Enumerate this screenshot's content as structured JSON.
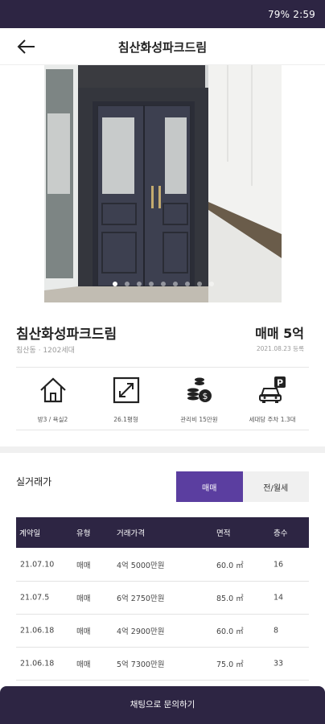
{
  "status_bar": {
    "text": "79% 2:59"
  },
  "header": {
    "title": "침산화성파크드림"
  },
  "gallery": {
    "slide_count": 9,
    "active_index": 0
  },
  "property": {
    "name": "침산화성파크드림",
    "subtitle": "침산동 · 1202세대",
    "price": "매매 5억",
    "date": "2021.08.23 등록"
  },
  "features": [
    {
      "icon": "house-icon",
      "label": "방3 / 욕실2"
    },
    {
      "icon": "expand-arrows-icon",
      "label": "26.1평형"
    },
    {
      "icon": "coins-icon",
      "label": "관리비 15만원"
    },
    {
      "icon": "car-parking-icon",
      "label": "세대당 주차 1.3대"
    }
  ],
  "transactions": {
    "title": "실거래가",
    "tabs": [
      {
        "label": "매매",
        "active": true
      },
      {
        "label": "전/월세",
        "active": false
      }
    ],
    "columns": [
      "계약일",
      "유형",
      "거래가격",
      "면적",
      "층수"
    ],
    "rows": [
      [
        "21.07.10",
        "매매",
        "4억 5000만원",
        "60.0 ㎡",
        "16"
      ],
      [
        "21.07.5",
        "매매",
        "6억 2750만원",
        "85.0 ㎡",
        "14"
      ],
      [
        "21.06.18",
        "매매",
        "4억 2900만원",
        "60.0 ㎡",
        "8"
      ],
      [
        "21.06.18",
        "매매",
        "5억 7300만원",
        "75.0 ㎡",
        "33"
      ]
    ]
  },
  "cta": {
    "label": "채팅으로 문의하기"
  },
  "colors": {
    "primary_dark": "#2d2543",
    "accent_purple": "#5b3ea0"
  }
}
